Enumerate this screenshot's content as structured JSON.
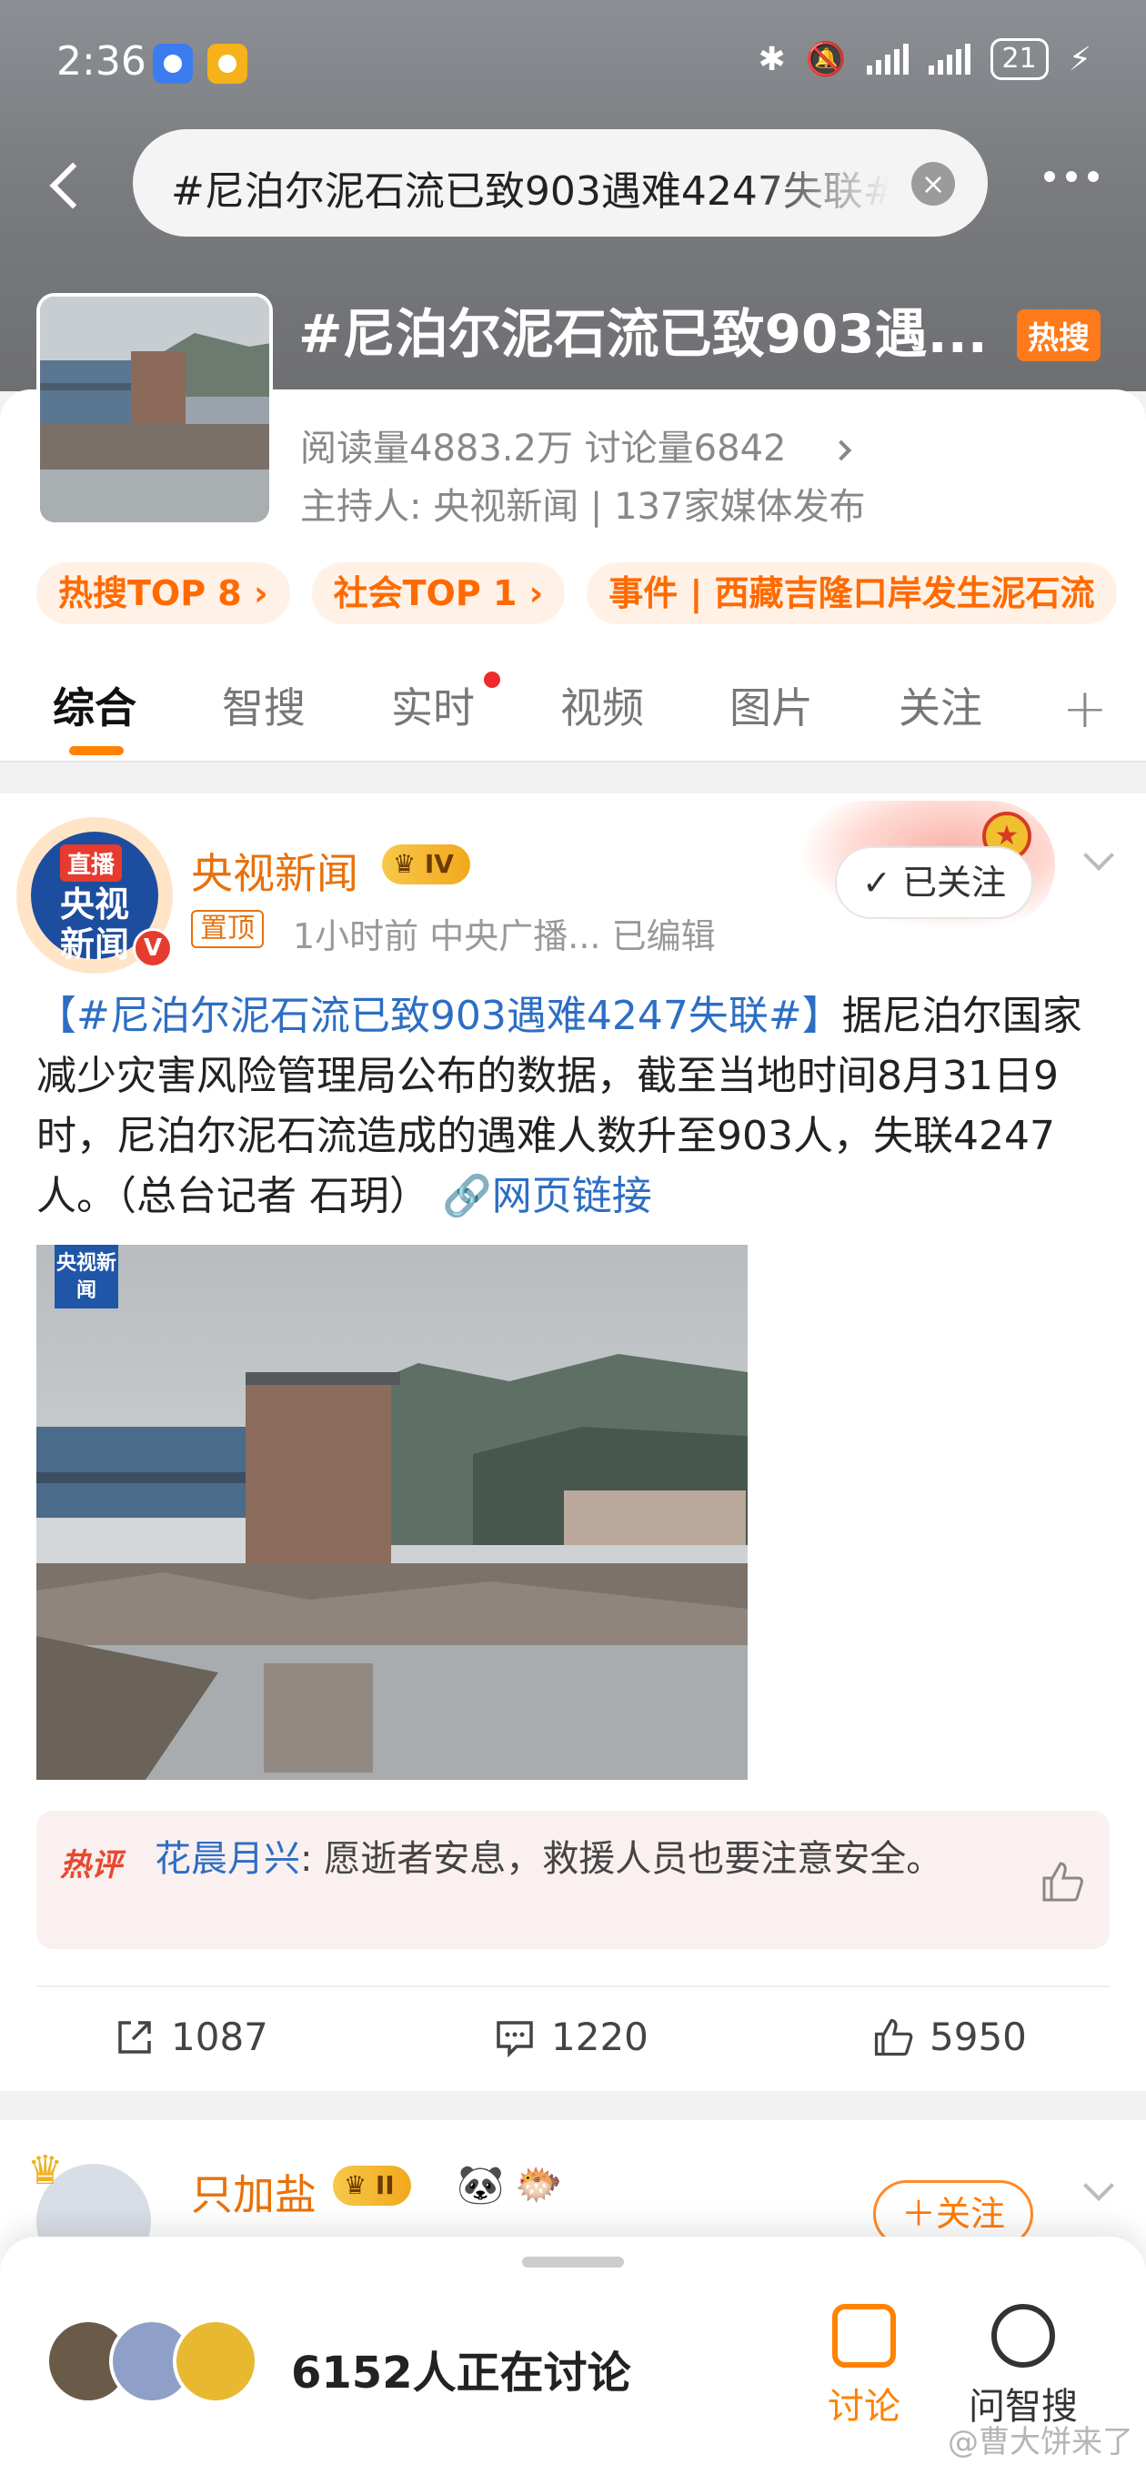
{
  "status_bar": {
    "time": "2:36",
    "battery": "21",
    "icons": [
      "weibo-app-icon",
      "bluetooth-icon",
      "mute-icon",
      "signal-icon",
      "charging-icon"
    ]
  },
  "search": {
    "query": "#尼泊尔泥石流已致903遇难4247失联#"
  },
  "topic": {
    "title": "#尼泊尔泥石流已致903遇...",
    "hot_badge": "热搜",
    "stats": "阅读量4883.2万  讨论量6842",
    "host": "主持人: 央视新闻 | 137家媒体发布",
    "chips": [
      "热搜TOP 8 ›",
      "社会TOP 1 ›",
      "事件 | 西藏吉隆口岸发生泥石流"
    ]
  },
  "tabs": [
    "综合",
    "智搜",
    "实时",
    "视频",
    "图片",
    "关注"
  ],
  "post1": {
    "avatar_tag": "直播",
    "avatar_text": "央视新闻",
    "author": "央视新闻",
    "level": "IV",
    "pin": "置顶",
    "meta": "1小时前  中央广播...  已编辑",
    "followed_label": "✓ 已关注",
    "hashtag": "【#尼泊尔泥石流已致903遇难4247失联#】",
    "body": "据尼泊尔国家减少灾害风险管理局公布的数据，截至当地时间8月31日9时，尼泊尔泥石流造成的遇难人数升至903人，失联4247人。（总台记者 石玥）",
    "link": "网页链接",
    "image_logo": "央视新闻",
    "hot_comment_tag": "热评",
    "hot_comment_user": "花晨月兴",
    "hot_comment_text": ": 愿逝者安息，救援人员也要注意安全。",
    "reposts": "1087",
    "comments": "1220",
    "likes": "5950"
  },
  "post2": {
    "author": "只加盐",
    "level": "II",
    "follow_label": "＋关注"
  },
  "sheet": {
    "discussing": "6152人正在讨论",
    "discuss_label": "讨论",
    "ask_label": "问智搜"
  },
  "watermark": "@曹大饼来了",
  "colors": {
    "accent": "#ff8200",
    "link": "#2d6ec4",
    "author": "#e8710a"
  }
}
